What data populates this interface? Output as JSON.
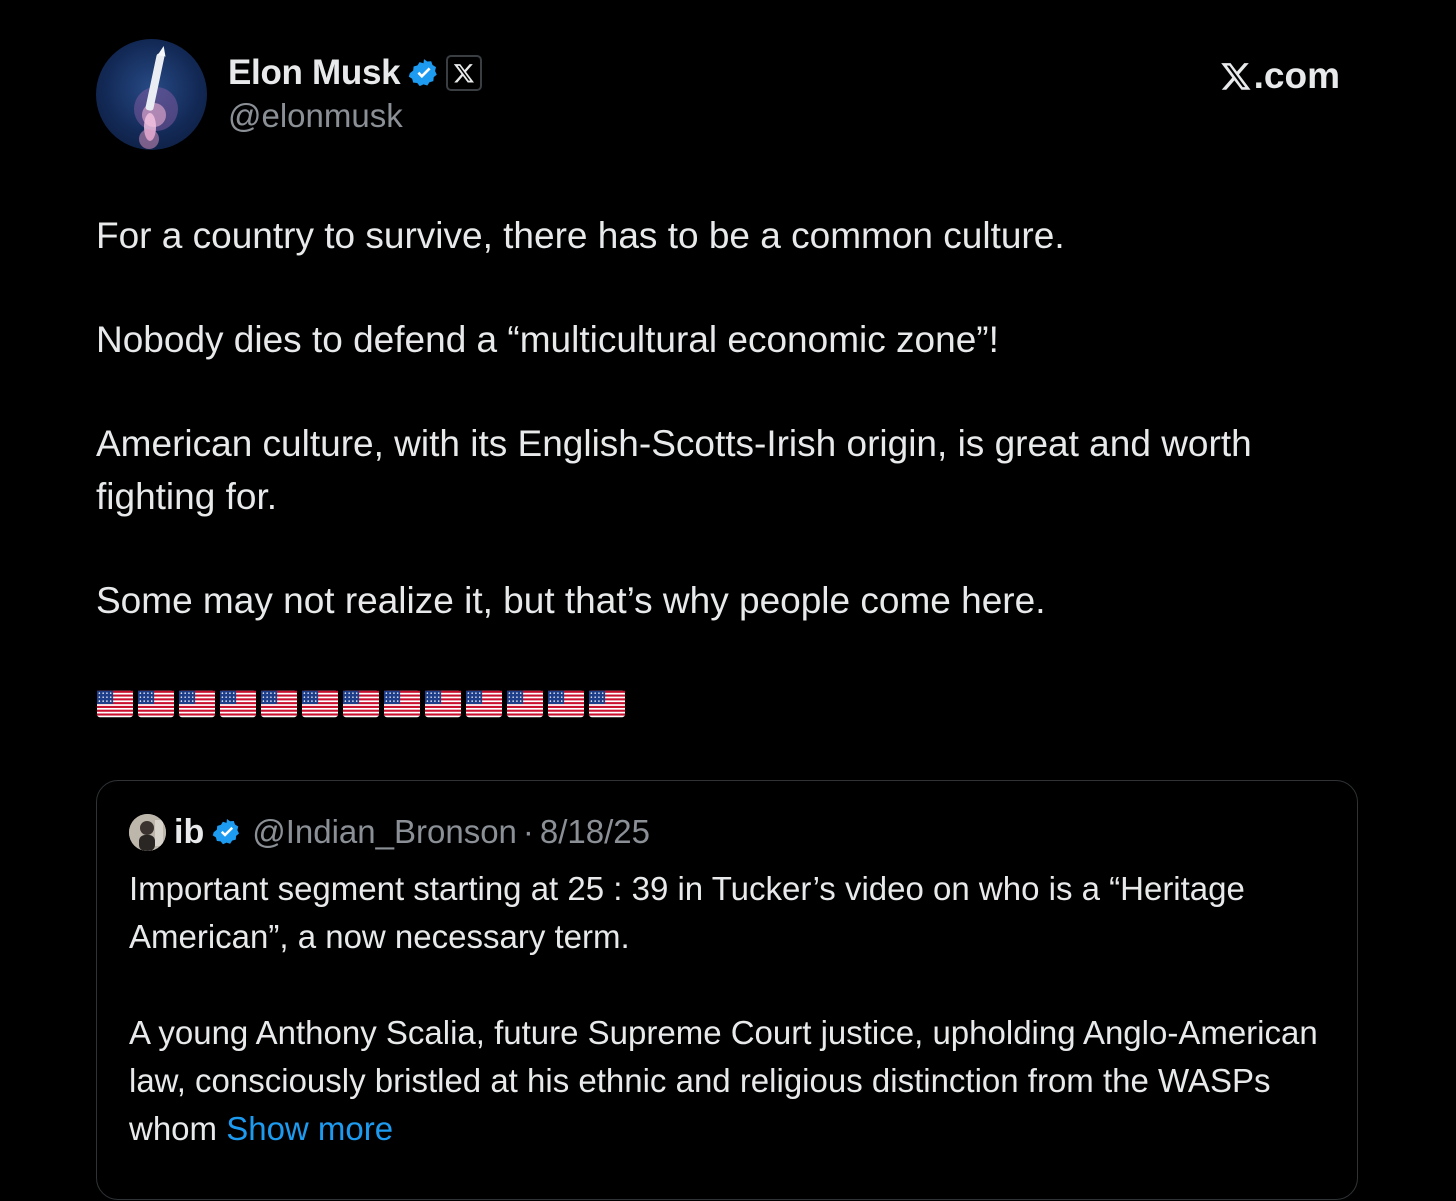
{
  "author": {
    "display_name": "Elon Musk",
    "handle": "@elonmusk",
    "verified_color": "#1d9bf0"
  },
  "brand": {
    "x_glyph": "𝕏",
    "suffix": ".com"
  },
  "tweet": {
    "paragraphs": [
      "For a country to survive, there has to be a common culture.",
      "Nobody dies to defend a “multicultural economic zone”!",
      "American culture, with its English-Scotts-Irish origin, is great and worth fighting for.",
      "Some may not realize it, but that’s why people come here."
    ],
    "flag_count": 13
  },
  "quote": {
    "display_name": "ib",
    "handle": "@Indian_Bronson",
    "separator": "·",
    "date": "8/18/25",
    "paragraph_1": "Important segment starting at 25 : 39  in Tucker’s video on who is a “Heritage American”, a now necessary term.",
    "paragraph_2": "A young Anthony Scalia, future Supreme Court justice, upholding Anglo-American law, consciously bristled at his ethnic and religious distinction from the WASPs whom ",
    "show_more": "Show more"
  }
}
